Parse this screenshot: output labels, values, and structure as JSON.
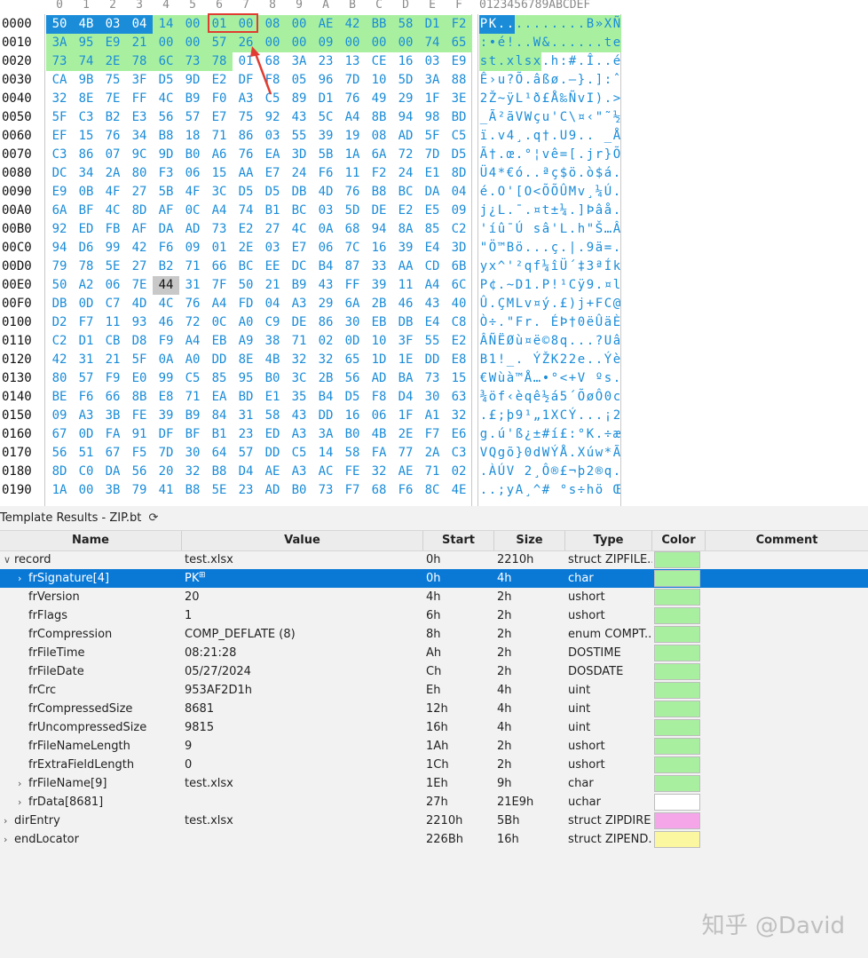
{
  "hex_view": {
    "column_headers": [
      "0",
      "1",
      "2",
      "3",
      "4",
      "5",
      "6",
      "7",
      "8",
      "9",
      "A",
      "B",
      "C",
      "D",
      "E",
      "F"
    ],
    "ascii_header": "0123456789ABCDEF",
    "rows": [
      {
        "addr": "0000",
        "bytes": [
          "50",
          "4B",
          "03",
          "04",
          "14",
          "00",
          "01",
          "00",
          "08",
          "00",
          "AE",
          "42",
          "BB",
          "58",
          "D1",
          "F2"
        ],
        "ascii": "PK..........B»XÑò"
      },
      {
        "addr": "0010",
        "bytes": [
          "3A",
          "95",
          "E9",
          "21",
          "00",
          "00",
          "57",
          "26",
          "00",
          "00",
          "09",
          "00",
          "00",
          "00",
          "74",
          "65"
        ],
        "ascii": ":•é!..W&......te"
      },
      {
        "addr": "0020",
        "bytes": [
          "73",
          "74",
          "2E",
          "78",
          "6C",
          "73",
          "78",
          "01",
          "68",
          "3A",
          "23",
          "13",
          "CE",
          "16",
          "03",
          "E9"
        ],
        "ascii": "st.xlsx.h:#.Î..é"
      },
      {
        "addr": "0030",
        "bytes": [
          "CA",
          "9B",
          "75",
          "3F",
          "D5",
          "9D",
          "E2",
          "DF",
          "F8",
          "05",
          "96",
          "7D",
          "10",
          "5D",
          "3A",
          "88"
        ],
        "ascii": "Ê›u?Õ.âßø.–}.]:ˆ"
      },
      {
        "addr": "0040",
        "bytes": [
          "32",
          "8E",
          "7E",
          "FF",
          "4C",
          "B9",
          "F0",
          "A3",
          "C5",
          "89",
          "D1",
          "76",
          "49",
          "29",
          "1F",
          "3E"
        ],
        "ascii": "2Ž~ÿL¹ð£Å‰ÑvI).>"
      },
      {
        "addr": "0050",
        "bytes": [
          "5F",
          "C3",
          "B2",
          "E3",
          "56",
          "57",
          "E7",
          "75",
          "92",
          "43",
          "5C",
          "A4",
          "8B",
          "94",
          "98",
          "BD"
        ],
        "ascii": "_Ã²ãVWçu'C\\¤‹\"˜½"
      },
      {
        "addr": "0060",
        "bytes": [
          "EF",
          "15",
          "76",
          "34",
          "B8",
          "18",
          "71",
          "86",
          "03",
          "55",
          "39",
          "19",
          "08",
          "AD",
          "5F",
          "C5"
        ],
        "ascii": "ï.v4¸.q†.U9..­_Å"
      },
      {
        "addr": "0070",
        "bytes": [
          "C3",
          "86",
          "07",
          "9C",
          "9D",
          "B0",
          "A6",
          "76",
          "EA",
          "3D",
          "5B",
          "1A",
          "6A",
          "72",
          "7D",
          "D5"
        ],
        "ascii": "Ã†.œ.°¦vê=[.jr}Õ"
      },
      {
        "addr": "0080",
        "bytes": [
          "DC",
          "34",
          "2A",
          "80",
          "F3",
          "06",
          "15",
          "AA",
          "E7",
          "24",
          "F6",
          "11",
          "F2",
          "24",
          "E1",
          "8D"
        ],
        "ascii": "Ü4*€ó..ªç$ö.ò$á."
      },
      {
        "addr": "0090",
        "bytes": [
          "E9",
          "0B",
          "4F",
          "27",
          "5B",
          "4F",
          "3C",
          "D5",
          "D5",
          "DB",
          "4D",
          "76",
          "B8",
          "BC",
          "DA",
          "04"
        ],
        "ascii": "é.O'[O<ÕÕÛMv¸¼Ú."
      },
      {
        "addr": "00A0",
        "bytes": [
          "6A",
          "BF",
          "4C",
          "8D",
          "AF",
          "0C",
          "A4",
          "74",
          "B1",
          "BC",
          "03",
          "5D",
          "DE",
          "E2",
          "E5",
          "09"
        ],
        "ascii": "j¿L.¯.¤t±¼.]Þâå."
      },
      {
        "addr": "00B0",
        "bytes": [
          "92",
          "ED",
          "FB",
          "AF",
          "DA",
          "AD",
          "73",
          "E2",
          "27",
          "4C",
          "0A",
          "68",
          "94",
          "8A",
          "85",
          "C2"
        ],
        "ascii": "'íû¯Ú­sâ'L.h\"Š…Â"
      },
      {
        "addr": "00C0",
        "bytes": [
          "94",
          "D6",
          "99",
          "42",
          "F6",
          "09",
          "01",
          "2E",
          "03",
          "E7",
          "06",
          "7C",
          "16",
          "39",
          "E4",
          "3D"
        ],
        "ascii": "\"Ö™Bö...ç.|.9ä="
      },
      {
        "addr": "00D0",
        "bytes": [
          "79",
          "78",
          "5E",
          "27",
          "B2",
          "71",
          "66",
          "BC",
          "EE",
          "DC",
          "B4",
          "87",
          "33",
          "AA",
          "CD",
          "6B"
        ],
        "ascii": "yx^'²qf¼îÜ´‡3ªÍk"
      },
      {
        "addr": "00E0",
        "bytes": [
          "50",
          "A2",
          "06",
          "7E",
          "44",
          "31",
          "7F",
          "50",
          "21",
          "B9",
          "43",
          "FF",
          "39",
          "11",
          "A4",
          "6C"
        ],
        "ascii": "P¢.~D1.P!¹Cÿ9.¤l"
      },
      {
        "addr": "00F0",
        "bytes": [
          "DB",
          "0D",
          "C7",
          "4D",
          "4C",
          "76",
          "A4",
          "FD",
          "04",
          "A3",
          "29",
          "6A",
          "2B",
          "46",
          "43",
          "40"
        ],
        "ascii": "Û.ÇMLv¤ý.£)j+FC@"
      },
      {
        "addr": "0100",
        "bytes": [
          "D2",
          "F7",
          "11",
          "93",
          "46",
          "72",
          "0C",
          "A0",
          "C9",
          "DE",
          "86",
          "30",
          "EB",
          "DB",
          "E4",
          "C8"
        ],
        "ascii": "Ò÷.\"Fr. ÉÞ†0ëÛäÈ"
      },
      {
        "addr": "0110",
        "bytes": [
          "C2",
          "D1",
          "CB",
          "D8",
          "F9",
          "A4",
          "EB",
          "A9",
          "38",
          "71",
          "02",
          "0D",
          "10",
          "3F",
          "55",
          "E2"
        ],
        "ascii": "ÂÑËØù¤ë©8q...?Uâ"
      },
      {
        "addr": "0120",
        "bytes": [
          "42",
          "31",
          "21",
          "5F",
          "0A",
          "A0",
          "DD",
          "8E",
          "4B",
          "32",
          "32",
          "65",
          "1D",
          "1E",
          "DD",
          "E8"
        ],
        "ascii": "B1!_. ÝŽK22e..Ýè"
      },
      {
        "addr": "0130",
        "bytes": [
          "80",
          "57",
          "F9",
          "E0",
          "99",
          "C5",
          "85",
          "95",
          "B0",
          "3C",
          "2B",
          "56",
          "AD",
          "BA",
          "73",
          "15"
        ],
        "ascii": "€Wùà™Å…•°<+V­ºs."
      },
      {
        "addr": "0140",
        "bytes": [
          "BE",
          "F6",
          "66",
          "8B",
          "E8",
          "71",
          "EA",
          "BD",
          "E1",
          "35",
          "B4",
          "D5",
          "F8",
          "D4",
          "30",
          "63"
        ],
        "ascii": "¾öf‹èqê½á5´ÕøÔ0c"
      },
      {
        "addr": "0150",
        "bytes": [
          "09",
          "A3",
          "3B",
          "FE",
          "39",
          "B9",
          "84",
          "31",
          "58",
          "43",
          "DD",
          "16",
          "06",
          "1F",
          "A1",
          "32"
        ],
        "ascii": ".£;þ9¹„1XCÝ...¡2"
      },
      {
        "addr": "0160",
        "bytes": [
          "67",
          "0D",
          "FA",
          "91",
          "DF",
          "BF",
          "B1",
          "23",
          "ED",
          "A3",
          "3A",
          "B0",
          "4B",
          "2E",
          "F7",
          "E6"
        ],
        "ascii": "g.ú'ß¿±#í£:°K.÷æ"
      },
      {
        "addr": "0170",
        "bytes": [
          "56",
          "51",
          "67",
          "F5",
          "7D",
          "30",
          "64",
          "57",
          "DD",
          "C5",
          "14",
          "58",
          "FA",
          "77",
          "2A",
          "C3"
        ],
        "ascii": "VQgõ}0dWÝÅ.Xúw*Ã"
      },
      {
        "addr": "0180",
        "bytes": [
          "8D",
          "C0",
          "DA",
          "56",
          "20",
          "32",
          "B8",
          "D4",
          "AE",
          "A3",
          "AC",
          "FE",
          "32",
          "AE",
          "71",
          "02"
        ],
        "ascii": ".ÀÚV 2¸Ô®£¬þ2®q."
      },
      {
        "addr": "0190",
        "bytes": [
          "1A",
          "00",
          "3B",
          "79",
          "41",
          "B8",
          "5E",
          "23",
          "AD",
          "B0",
          "73",
          "F7",
          "68",
          "F6",
          "8C",
          "4E"
        ],
        "ascii": "..;yA¸^#­°s÷hö ŒN"
      }
    ]
  },
  "template": {
    "title": "Template Results - ZIP.bt",
    "refresh_icon": "refresh-icon",
    "columns": [
      "Name",
      "Value",
      "Start",
      "Size",
      "Type",
      "Color",
      "Comment"
    ],
    "rows": [
      {
        "name": "record",
        "value": "test.xlsx",
        "start": "0h",
        "size": "2210h",
        "type": "struct ZIPFILE...",
        "color": "#a8f0a0",
        "indent": 0,
        "expander": "open",
        "selected": false
      },
      {
        "name": "frSignature[4]",
        "value": "PK",
        "start": "0h",
        "size": "4h",
        "type": "char",
        "color": "#a8f0a0",
        "indent": 1,
        "expander": "closed",
        "selected": true
      },
      {
        "name": "frVersion",
        "value": "20",
        "start": "4h",
        "size": "2h",
        "type": "ushort",
        "color": "#a8f0a0",
        "indent": 1,
        "expander": "",
        "selected": false
      },
      {
        "name": "frFlags",
        "value": "1",
        "start": "6h",
        "size": "2h",
        "type": "ushort",
        "color": "#a8f0a0",
        "indent": 1,
        "expander": "",
        "selected": false
      },
      {
        "name": "frCompression",
        "value": "COMP_DEFLATE (8)",
        "start": "8h",
        "size": "2h",
        "type": "enum COMPT...",
        "color": "#a8f0a0",
        "indent": 1,
        "expander": "",
        "selected": false
      },
      {
        "name": "frFileTime",
        "value": "08:21:28",
        "start": "Ah",
        "size": "2h",
        "type": "DOSTIME",
        "color": "#a8f0a0",
        "indent": 1,
        "expander": "",
        "selected": false
      },
      {
        "name": "frFileDate",
        "value": "05/27/2024",
        "start": "Ch",
        "size": "2h",
        "type": "DOSDATE",
        "color": "#a8f0a0",
        "indent": 1,
        "expander": "",
        "selected": false
      },
      {
        "name": "frCrc",
        "value": "953AF2D1h",
        "start": "Eh",
        "size": "4h",
        "type": "uint",
        "color": "#a8f0a0",
        "indent": 1,
        "expander": "",
        "selected": false
      },
      {
        "name": "frCompressedSize",
        "value": "8681",
        "start": "12h",
        "size": "4h",
        "type": "uint",
        "color": "#a8f0a0",
        "indent": 1,
        "expander": "",
        "selected": false
      },
      {
        "name": "frUncompressedSize",
        "value": "9815",
        "start": "16h",
        "size": "4h",
        "type": "uint",
        "color": "#a8f0a0",
        "indent": 1,
        "expander": "",
        "selected": false
      },
      {
        "name": "frFileNameLength",
        "value": "9",
        "start": "1Ah",
        "size": "2h",
        "type": "ushort",
        "color": "#a8f0a0",
        "indent": 1,
        "expander": "",
        "selected": false
      },
      {
        "name": "frExtraFieldLength",
        "value": "0",
        "start": "1Ch",
        "size": "2h",
        "type": "ushort",
        "color": "#a8f0a0",
        "indent": 1,
        "expander": "",
        "selected": false
      },
      {
        "name": "frFileName[9]",
        "value": "test.xlsx",
        "start": "1Eh",
        "size": "9h",
        "type": "char",
        "color": "#a8f0a0",
        "indent": 1,
        "expander": "closed",
        "selected": false
      },
      {
        "name": "frData[8681]",
        "value": "",
        "start": "27h",
        "size": "21E9h",
        "type": "uchar",
        "color": "#ffffff",
        "indent": 1,
        "expander": "closed",
        "selected": false
      },
      {
        "name": "dirEntry",
        "value": "test.xlsx",
        "start": "2210h",
        "size": "5Bh",
        "type": "struct ZIPDIRE...",
        "color": "#f4a6e8",
        "indent": 0,
        "expander": "closed",
        "selected": false
      },
      {
        "name": "endLocator",
        "value": "",
        "start": "226Bh",
        "size": "16h",
        "type": "struct ZIPEND...",
        "color": "#fbf7a0",
        "indent": 0,
        "expander": "closed",
        "selected": false
      }
    ]
  },
  "watermark": "知乎 @David",
  "colors": {
    "hex_text": "#1a8cd8",
    "highlight_green": "#a8f0a0",
    "selected_blue": "#0a79d6",
    "header_cell_blue": "#1a8cd8",
    "annotation_red": "#e03c31"
  }
}
